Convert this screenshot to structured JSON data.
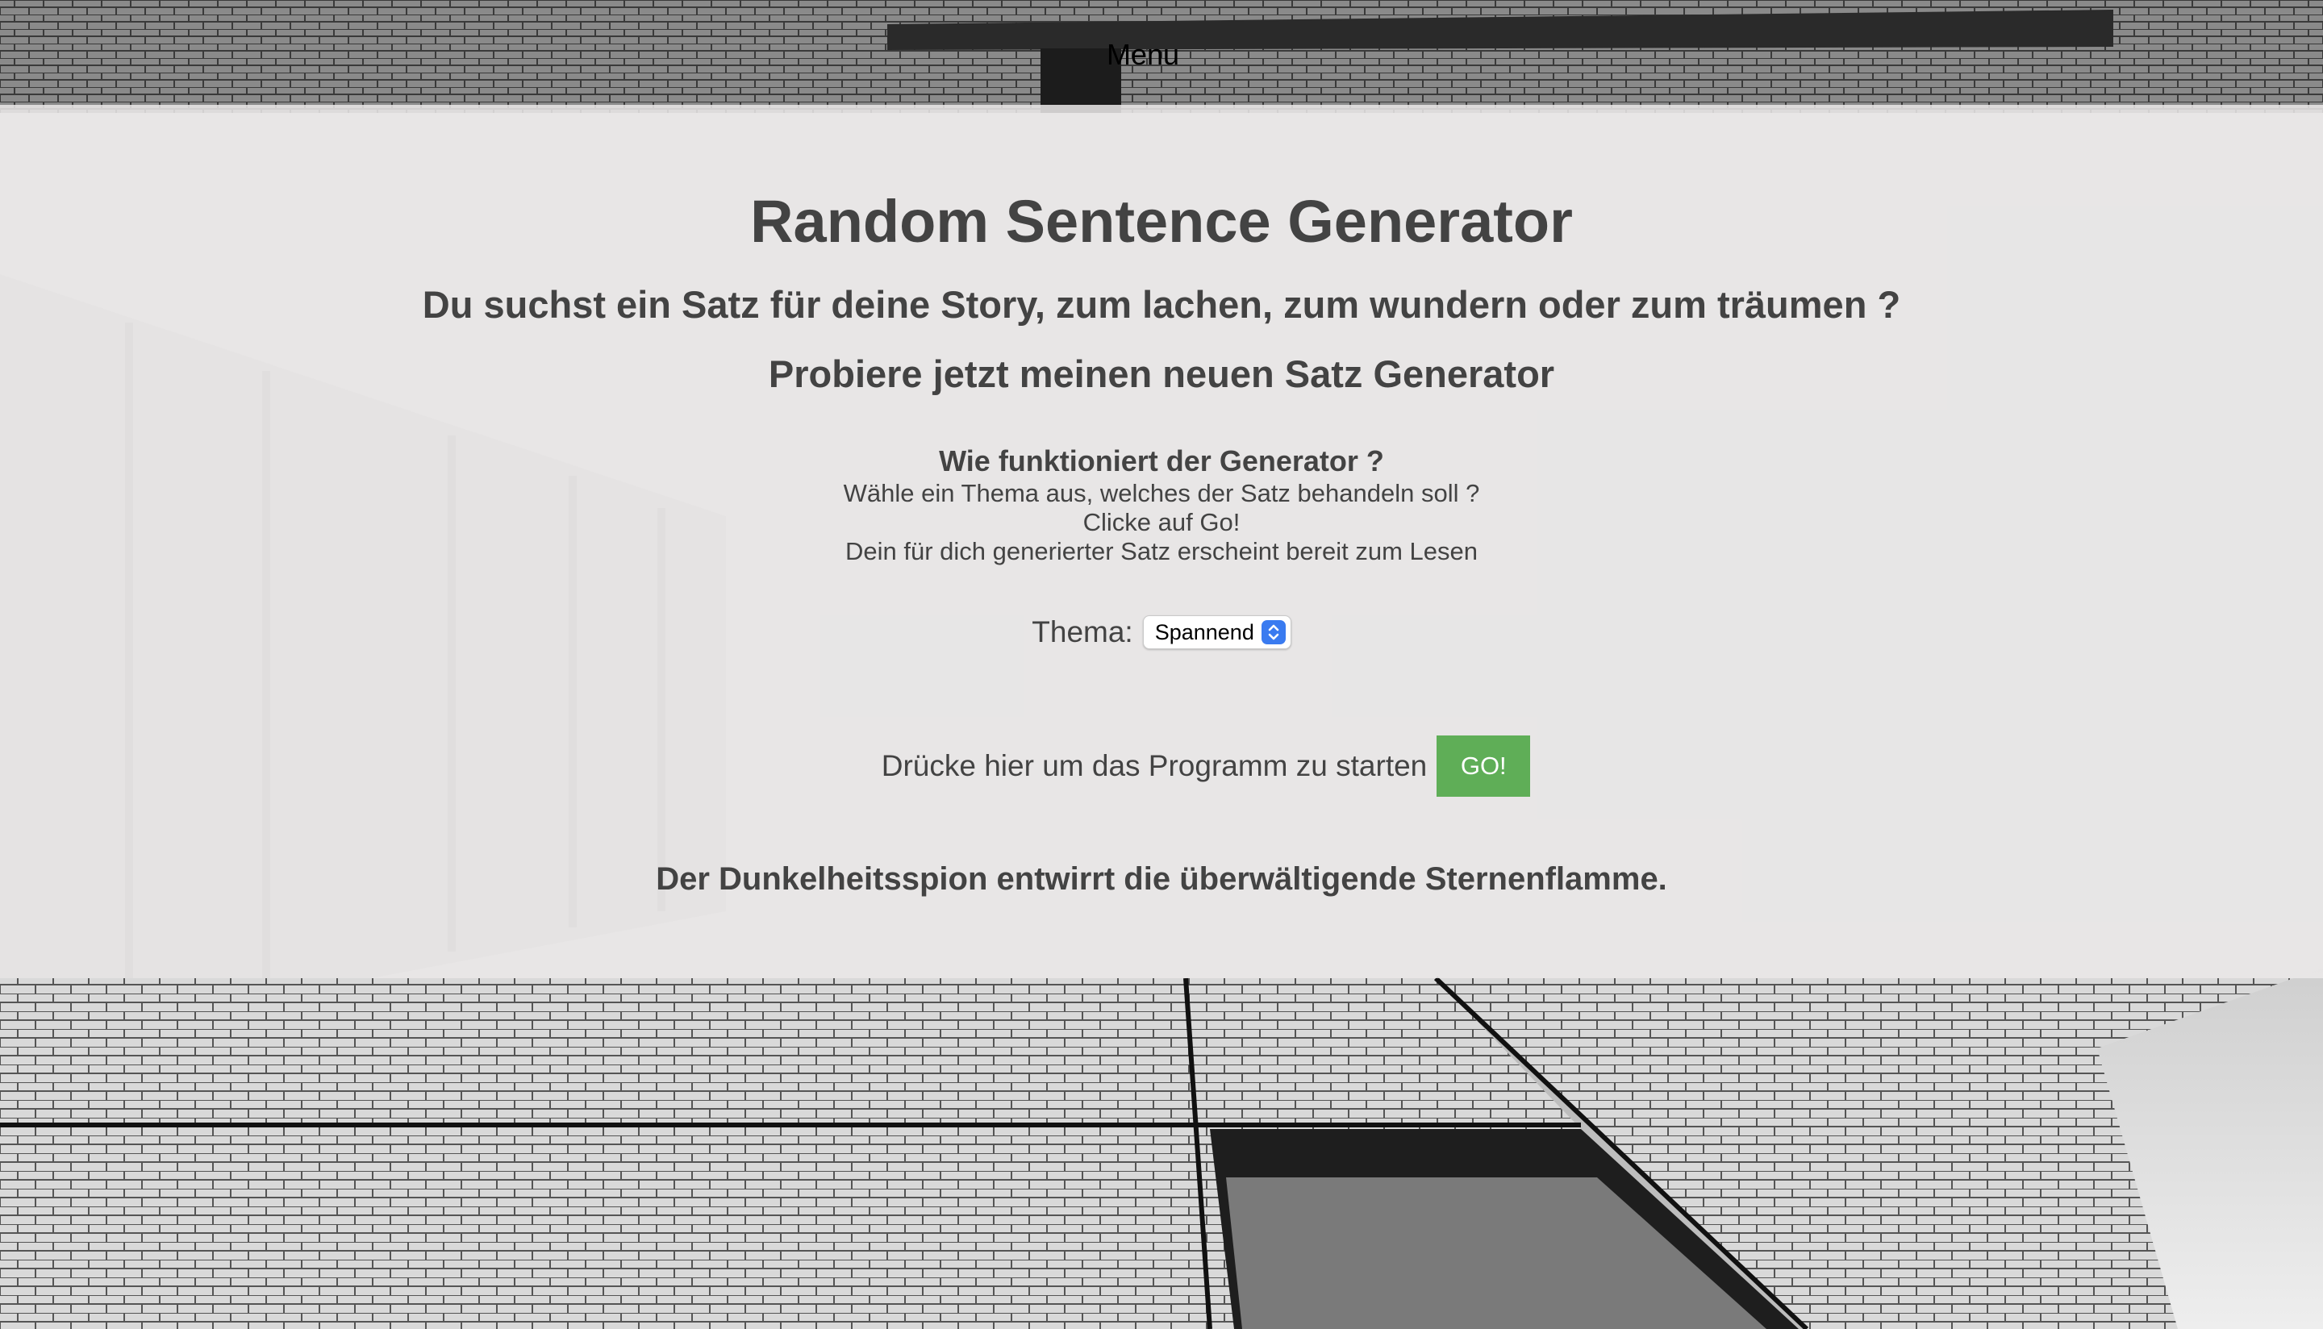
{
  "menu": {
    "label": "Menu"
  },
  "header": {
    "title": "Random Sentence Generator",
    "subtitle": "Du suchst ein Satz für deine Story, zum lachen, zum wundern oder zum träumen ?",
    "tagline": "Probiere jetzt meinen neuen Satz Generator"
  },
  "how_it_works": {
    "heading": "Wie funktioniert der Generator ?",
    "steps": [
      "Wähle ein Thema aus, welches der Satz behandeln soll ?",
      "Clicke auf Go!",
      "Dein für dich generierter Satz erscheint bereit zum Lesen"
    ]
  },
  "theme": {
    "label": "Thema:",
    "selected": "Spannend"
  },
  "start": {
    "label": "Drücke hier um das Programm zu starten",
    "button_label": "GO!"
  },
  "result": {
    "sentence": "Der Dunkelheitsspion entwirrt die überwältigende Sternenflamme."
  },
  "colors": {
    "go_button": "#5fae57",
    "text": "#434343",
    "select_arrow": "#3a7bf0"
  },
  "icons": {
    "select_arrows": "chevron-up-down-icon"
  }
}
